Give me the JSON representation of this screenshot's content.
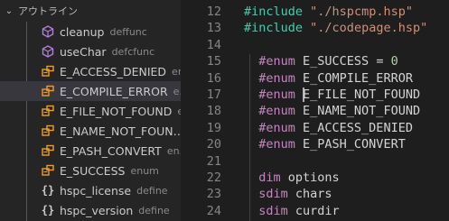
{
  "outline": {
    "title": "アウトライン",
    "items": [
      {
        "name": "cleanup",
        "kind": "deffunc",
        "icon": "cube-icon",
        "iconColor": "#b180d7"
      },
      {
        "name": "useChar",
        "kind": "defcfunc",
        "icon": "cube-icon",
        "iconColor": "#b180d7"
      },
      {
        "name": "E_ACCESS_DENIED",
        "kind": "en…",
        "icon": "enum-member-icon",
        "iconColor": "#ee9d28"
      },
      {
        "name": "E_COMPILE_ERROR",
        "kind": "e…",
        "icon": "enum-member-icon",
        "iconColor": "#ee9d28",
        "selected": true
      },
      {
        "name": "E_FILE_NOT_FOUND",
        "kind": "e…",
        "icon": "enum-member-icon",
        "iconColor": "#ee9d28"
      },
      {
        "name": "E_NAME_NOT_FOUN…",
        "kind": "",
        "icon": "enum-member-icon",
        "iconColor": "#ee9d28"
      },
      {
        "name": "E_PASH_CONVERT",
        "kind": "en…",
        "icon": "enum-member-icon",
        "iconColor": "#ee9d28"
      },
      {
        "name": "E_SUCCESS",
        "kind": "enum",
        "icon": "enum-member-icon",
        "iconColor": "#ee9d28"
      },
      {
        "name": "hspc_license",
        "kind": "define",
        "icon": "braces-icon",
        "iconColor": "#cccccc"
      },
      {
        "name": "hspc_version",
        "kind": "define",
        "icon": "braces-icon",
        "iconColor": "#cccccc"
      }
    ]
  },
  "editor": {
    "lines": [
      {
        "n": "12",
        "tokens": [
          [
            "#include",
            "kw-green"
          ],
          [
            " ",
            "op"
          ],
          [
            "\"./hspcmp.hsp\"",
            "str"
          ]
        ]
      },
      {
        "n": "13",
        "tokens": [
          [
            "#include",
            "kw-green"
          ],
          [
            " ",
            "op"
          ],
          [
            "\"./codepage.hsp\"",
            "str"
          ]
        ]
      },
      {
        "n": "14",
        "tokens": []
      },
      {
        "n": "15",
        "tokens": [
          [
            "  ",
            "op"
          ],
          [
            "#enum",
            "kw-ppc"
          ],
          [
            " E_SUCCESS ",
            "op"
          ],
          [
            "=",
            "op"
          ],
          [
            " ",
            "op"
          ],
          [
            "0",
            "num"
          ]
        ]
      },
      {
        "n": "16",
        "tokens": [
          [
            "  ",
            "op"
          ],
          [
            "#enum",
            "kw-ppc"
          ],
          [
            " E_COMPILE_ERROR",
            "op"
          ]
        ]
      },
      {
        "n": "17",
        "tokens": [
          [
            "  ",
            "op"
          ],
          [
            "#enum",
            "kw-ppc"
          ],
          [
            " ",
            "op"
          ],
          [
            "|",
            "cursor"
          ],
          [
            "E_FILE_NOT_FOUND",
            "op"
          ]
        ]
      },
      {
        "n": "18",
        "tokens": [
          [
            "  ",
            "op"
          ],
          [
            "#enum",
            "kw-ppc"
          ],
          [
            " E_NAME_NOT_FOUND",
            "op"
          ]
        ]
      },
      {
        "n": "19",
        "tokens": [
          [
            "  ",
            "op"
          ],
          [
            "#enum",
            "kw-ppc"
          ],
          [
            " E_ACCESS_DENIED",
            "op"
          ]
        ]
      },
      {
        "n": "20",
        "tokens": [
          [
            "  ",
            "op"
          ],
          [
            "#enum",
            "kw-ppc"
          ],
          [
            " E_PASH_CONVERT",
            "op"
          ]
        ]
      },
      {
        "n": "21",
        "tokens": []
      },
      {
        "n": "22",
        "tokens": [
          [
            "  ",
            "op"
          ],
          [
            "dim",
            "kw-blue"
          ],
          [
            " options",
            "op"
          ]
        ]
      },
      {
        "n": "23",
        "tokens": [
          [
            "  ",
            "op"
          ],
          [
            "sdim",
            "kw-blue"
          ],
          [
            " chars",
            "op"
          ]
        ]
      },
      {
        "n": "24",
        "tokens": [
          [
            "  ",
            "op"
          ],
          [
            "sdim",
            "kw-blue"
          ],
          [
            " curdir",
            "op"
          ]
        ]
      }
    ]
  },
  "colors": {
    "accent": "#007acc",
    "selection": "#37373d"
  }
}
